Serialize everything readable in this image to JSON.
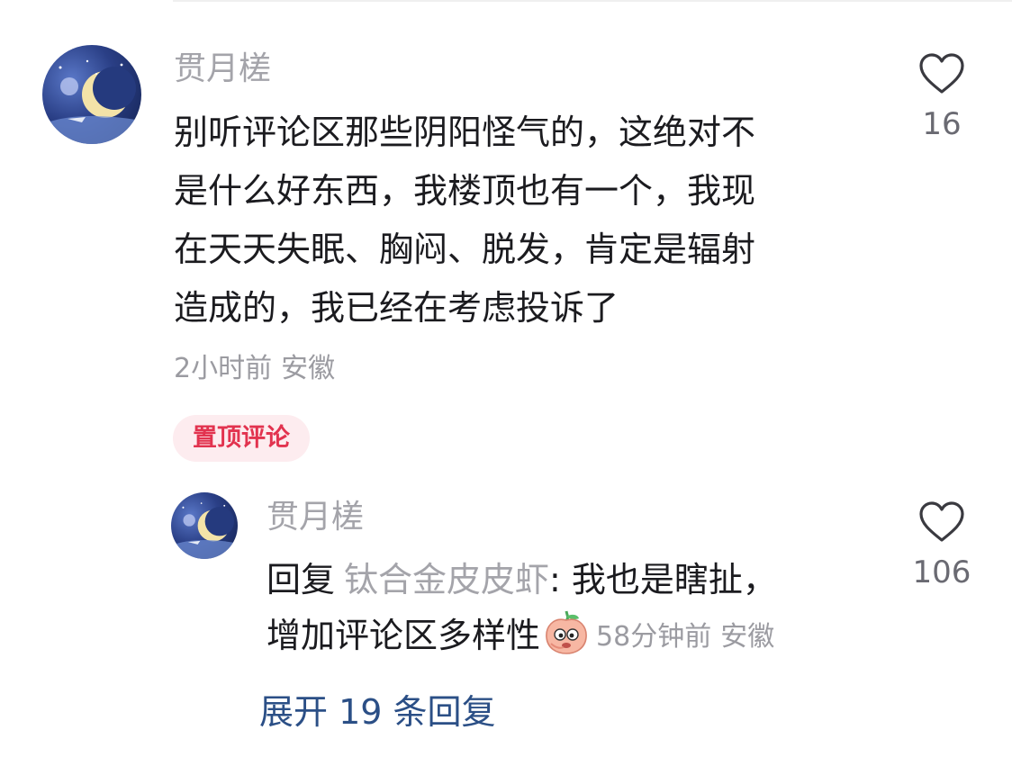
{
  "comment": {
    "author": "贯月槎",
    "content_lines": [
      "别听评论区那些阴阳怪气的，这绝对不",
      "是什么好东西，我楼顶也有一个，我现",
      "在天天失眠、胸闷、脱发，肯定是辐射",
      "造成的，我已经在考虑投诉了"
    ],
    "time": "2小时前",
    "location": "安徽",
    "pinned_label": "置顶评论",
    "like_count": "16",
    "like_icon": "heart-outline-icon"
  },
  "reply": {
    "author": "贯月槎",
    "reply_prefix": "回复",
    "reply_to": "钛合金皮皮虾",
    "text_line1": ": 我也是瞎扯，",
    "text_line2": "增加评论区多样性",
    "emoji": "peach-face-emoji",
    "time": "58分钟前",
    "location": "安徽",
    "like_count": "106"
  },
  "expand_replies": "展开 19 条回复",
  "colors": {
    "name_gray": "#a4a4aa",
    "text_black": "#1b1b1f",
    "pin_bg": "#fdecef",
    "pin_text": "#e2334f",
    "expand_blue": "#2b4f86"
  }
}
